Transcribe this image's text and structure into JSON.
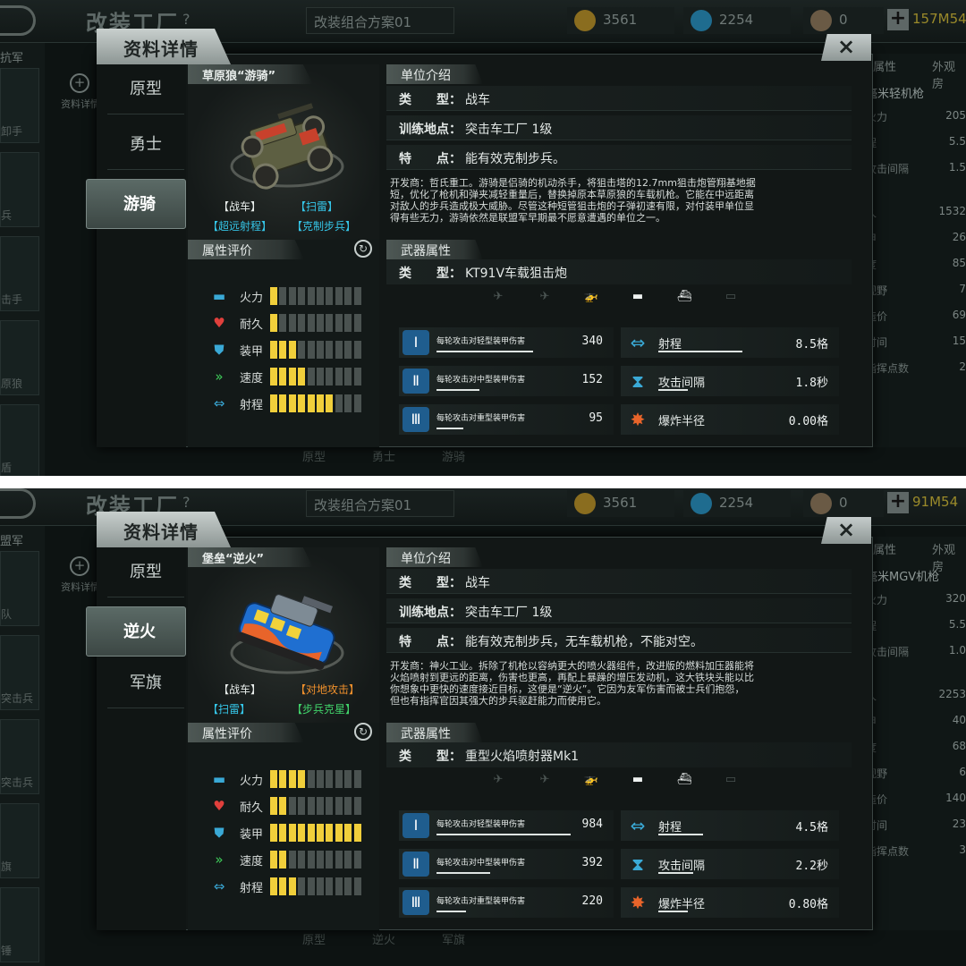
{
  "screens": [
    {
      "background": {
        "title": "改装工厂",
        "help": "?",
        "plan_name": "改装组合方案01",
        "coins": "3561",
        "gems": "2254",
        "tickets": "0",
        "gold_partial": "157M54",
        "left_label": "抗军",
        "left_cells": [
          "卸手",
          "兵",
          "击手",
          "原狼",
          "盾"
        ],
        "zoom_label": "资料详情",
        "right_tabs": [
          "属性",
          "外观房"
        ],
        "right_title": "毫米轻机枪",
        "right_rows": [
          {
            "label": "火力",
            "value": "205"
          },
          {
            "label": "程",
            "value": "5.5"
          },
          {
            "label": "攻击间隔",
            "value": "1.5"
          },
          {
            "label": "久",
            "value": "1532"
          },
          {
            "label": "甲",
            "value": "26"
          },
          {
            "label": "度",
            "value": "85"
          },
          {
            "label": "视野",
            "value": "7"
          },
          {
            "label": "造价",
            "value": "69"
          },
          {
            "label": "时间",
            "value": "15"
          },
          {
            "label": "指挥点数",
            "value": "2"
          }
        ],
        "bottom_tabs": [
          "原型",
          "勇士",
          "游骑"
        ]
      },
      "dialog": {
        "title": "资料详情",
        "close": "×",
        "tabs": [
          "原型",
          "勇士",
          "游骑"
        ],
        "active_tab": 2,
        "unit_name": "草原狼“游骑”",
        "tags": [
          {
            "text": "【战车】",
            "color": "w"
          },
          {
            "text": "【扫雷】",
            "color": "c"
          },
          {
            "text": "【超远射程】",
            "color": "c"
          },
          {
            "text": "【克制步兵】",
            "color": "c"
          }
        ],
        "attr_header": "属性评价",
        "attributes": [
          {
            "label": "火力",
            "level": 1
          },
          {
            "label": "耐久",
            "level": 1
          },
          {
            "label": "装甲",
            "level": 3
          },
          {
            "label": "速度",
            "level": 4
          },
          {
            "label": "射程",
            "level": 7
          }
        ],
        "intro_header": "单位介绍",
        "intro": [
          {
            "key": "类　　型：",
            "value": "战车"
          },
          {
            "key": "训练地点：",
            "value": "突击车工厂 1级"
          },
          {
            "key": "特　　点：",
            "value": "能有效克制步兵。"
          }
        ],
        "description": [
          "开发商：哲氏重工。游骑是侣骑的机动杀手，将狙击塔的12.7mm狙击炮管翔基地据",
          "短，优化了枪机和弹夹减轻重量后，替换掉原本草原狼的车载机枪。它能在中远距离",
          "对敌人的步兵造成极大威胁。尽管这种短管狙击炮的子弹初速有限，对付装甲单位显",
          "得有些无力，游骑依然是联盟军早期最不愿意遭遇的单位之一。"
        ],
        "weapon_header": "武器属性",
        "weapon_type_key": "类　　型：",
        "weapon_type": "KT91V车载狙击炮",
        "targets": [
          {
            "icon": "✈",
            "on": false
          },
          {
            "icon": "✈",
            "on": false
          },
          {
            "icon": "🚁",
            "on": true
          },
          {
            "icon": "▬",
            "on": true
          },
          {
            "icon": "⛴",
            "on": true
          },
          {
            "icon": "▭",
            "on": false
          }
        ],
        "stats_left": [
          {
            "label": "每轮攻击对轻型装甲伤害",
            "value": "340",
            "fill": 0.72
          },
          {
            "label": "每轮攻击对中型装甲伤害",
            "value": "152",
            "fill": 0.32
          },
          {
            "label": "每轮攻击对重型装甲伤害",
            "value": "95",
            "fill": 0.2
          }
        ],
        "stats_right": [
          {
            "label": "射程",
            "value": "8.5格",
            "fill": 0.85
          },
          {
            "label": "攻击间隔",
            "value": "1.8秒",
            "fill": 0.3
          },
          {
            "label": "爆炸半径",
            "value": "0.00格",
            "fill": 0.0
          }
        ]
      }
    },
    {
      "background": {
        "title": "改装工厂",
        "help": "?",
        "plan_name": "改装组合方案01",
        "coins": "3561",
        "gems": "2254",
        "tickets": "0",
        "gold_partial": "91M54",
        "left_label": "盟军",
        "left_cells": [
          "队",
          "突击兵",
          "突击兵",
          "旗",
          "锤"
        ],
        "zoom_label": "资料详情",
        "right_tabs": [
          "属性",
          "外观房"
        ],
        "right_title": "毫米MGV机枪",
        "right_rows": [
          {
            "label": "火力",
            "value": "320"
          },
          {
            "label": "程",
            "value": "5.5"
          },
          {
            "label": "攻击间隔",
            "value": "1.0"
          },
          {
            "label": "久",
            "value": "2253"
          },
          {
            "label": "甲",
            "value": "40"
          },
          {
            "label": "度",
            "value": "68"
          },
          {
            "label": "视野",
            "value": "6"
          },
          {
            "label": "造价",
            "value": "140"
          },
          {
            "label": "时间",
            "value": "23"
          },
          {
            "label": "指挥点数",
            "value": "3"
          }
        ],
        "bottom_tabs": [
          "原型",
          "逆火",
          "军旗"
        ]
      },
      "dialog": {
        "title": "资料详情",
        "close": "×",
        "tabs": [
          "原型",
          "逆火",
          "军旗"
        ],
        "active_tab": 1,
        "unit_name": "堡垒“逆火”",
        "tags": [
          {
            "text": "【战车】",
            "color": "w"
          },
          {
            "text": "【对地攻击】",
            "color": "o"
          },
          {
            "text": "【扫雷】",
            "color": "c"
          },
          {
            "text": "【步兵克星】",
            "color": "g"
          }
        ],
        "attr_header": "属性评价",
        "attributes": [
          {
            "label": "火力",
            "level": 4
          },
          {
            "label": "耐久",
            "level": 2
          },
          {
            "label": "装甲",
            "level": 10
          },
          {
            "label": "速度",
            "level": 2
          },
          {
            "label": "射程",
            "level": 3
          }
        ],
        "intro_header": "单位介绍",
        "intro": [
          {
            "key": "类　　型：",
            "value": "战车"
          },
          {
            "key": "训练地点：",
            "value": "突击车工厂 1级"
          },
          {
            "key": "特　　点：",
            "value": "能有效克制步兵，无车载机枪，不能对空。"
          }
        ],
        "description": [
          "开发商：神火工业。拆除了机枪以容纳更大的喷火器组件，改进版的燃料加压器能将",
          "火焰喷射到更远的距离，伤害也更高，再配上暴躁的增压发动机，这大铁块头能以比",
          "你想象中更快的速度接近目标，这便是“逆火”。它因为友军伤害而被士兵们抱怨，",
          "但也有指挥官因其强大的步兵驱赶能力而使用它。"
        ],
        "weapon_header": "武器属性",
        "weapon_type_key": "类　　型：",
        "weapon_type": "重型火焰喷射器Mk1",
        "targets": [
          {
            "icon": "✈",
            "on": false
          },
          {
            "icon": "✈",
            "on": false
          },
          {
            "icon": "🚁",
            "on": false
          },
          {
            "icon": "▬",
            "on": true
          },
          {
            "icon": "⛴",
            "on": true
          },
          {
            "icon": "▭",
            "on": false
          }
        ],
        "stats_left": [
          {
            "label": "每轮攻击对轻型装甲伤害",
            "value": "984",
            "fill": 1.0
          },
          {
            "label": "每轮攻击对中型装甲伤害",
            "value": "392",
            "fill": 0.4
          },
          {
            "label": "每轮攻击对重型装甲伤害",
            "value": "220",
            "fill": 0.22
          }
        ],
        "stats_right": [
          {
            "label": "射程",
            "value": "4.5格",
            "fill": 0.45
          },
          {
            "label": "攻击间隔",
            "value": "2.2秒",
            "fill": 0.35
          },
          {
            "label": "爆炸半径",
            "value": "0.80格",
            "fill": 0.3
          }
        ]
      }
    }
  ]
}
